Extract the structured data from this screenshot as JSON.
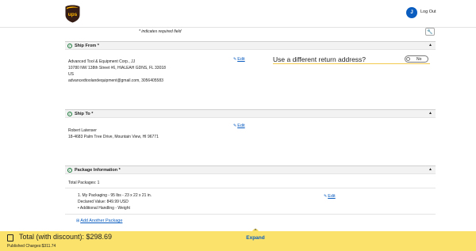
{
  "header": {
    "avatar_initial": "J",
    "logout_label": "Log Out"
  },
  "form": {
    "required_note": "* indicates required field"
  },
  "ship_from": {
    "title": "Ship From *",
    "address_lines": [
      "Advanced Tool & Equipment Corp., JJ",
      "10780 NW 138th Street #6, HIALEAH GDNS, FL 33018",
      "US",
      "advancedtoolandequipment@gmail.com, 3056405583"
    ],
    "edit_label": "Edit",
    "diff_return_label": "Use a different return address?",
    "toggle_label": "No"
  },
  "ship_to": {
    "title": "Ship To *",
    "address_lines": [
      "Robert Latenser",
      "18-4683 Palm Tree Drive, Mountain View, HI 96771"
    ],
    "edit_label": "Edit"
  },
  "package_info": {
    "title": "Package Information *",
    "total_packages": "Total Packages: 1",
    "package_lines": [
      "1. My Packaging - 95 lbs  - 23 x 22 x 21 in.",
      "Declared Value: 849.99 USD",
      "• Additional Handling - Weight"
    ],
    "edit_label": "Edit",
    "add_package_label": "Add Another Package"
  },
  "footer": {
    "total_label": "Total (with discount): $298.69",
    "published_label": "Published Charges:$311.74",
    "expand_label": "Expand"
  },
  "colors": {
    "footer_bg": "#fbe26a",
    "link": "#0a5cbf",
    "ups_brown": "#351c15",
    "ups_gold": "#ffb500"
  }
}
